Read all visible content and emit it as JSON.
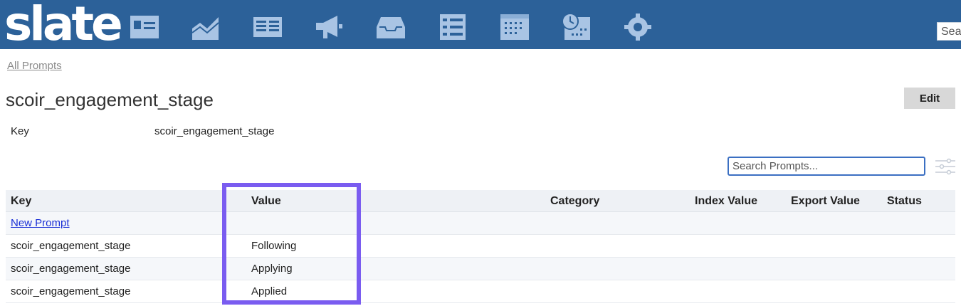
{
  "header": {
    "logo": "slate",
    "nav_icons": [
      "contact-card-icon",
      "chart-area-icon",
      "newspaper-icon",
      "megaphone-icon",
      "inbox-icon",
      "list-icon",
      "calendar-icon",
      "clock-calendar-icon",
      "gear-icon"
    ],
    "search_value": "Sear"
  },
  "breadcrumb": "All Prompts",
  "page": {
    "title": "scoir_engagement_stage",
    "edit_label": "Edit",
    "key_label": "Key",
    "key_value": "scoir_engagement_stage"
  },
  "search": {
    "placeholder": "Search Prompts..."
  },
  "table": {
    "columns": [
      "Key",
      "Value",
      "Category",
      "Index Value",
      "Export Value",
      "Status"
    ],
    "new_prompt_label": "New Prompt",
    "rows": [
      {
        "key": "scoir_engagement_stage",
        "value": "Following",
        "category": "",
        "index": "",
        "export": "",
        "status": ""
      },
      {
        "key": "scoir_engagement_stage",
        "value": "Applying",
        "category": "",
        "index": "",
        "export": "",
        "status": ""
      },
      {
        "key": "scoir_engagement_stage",
        "value": "Applied",
        "category": "",
        "index": "",
        "export": "",
        "status": ""
      }
    ]
  },
  "colors": {
    "topbar": "#2c6199",
    "icon": "#a9c4e4",
    "highlight": "#7a5cf0",
    "link": "#1a2fd6"
  }
}
